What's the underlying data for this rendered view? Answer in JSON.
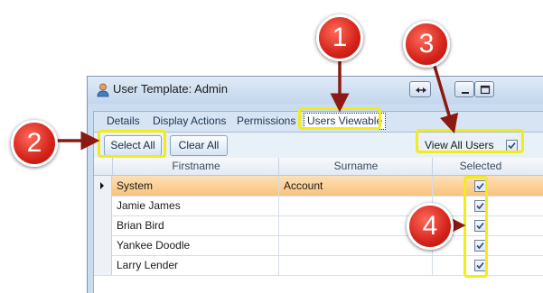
{
  "window": {
    "title": "User Template: Admin"
  },
  "tabs": [
    {
      "label": "Details"
    },
    {
      "label": "Display Actions"
    },
    {
      "label": "Permissions"
    },
    {
      "label": "Users Viewable"
    }
  ],
  "toolbar": {
    "select_all_label": "Select All",
    "clear_all_label": "Clear All",
    "view_all_label": "View All Users",
    "view_all_checked": true
  },
  "grid": {
    "columns": [
      "Firstname",
      "Surname",
      "Selected"
    ],
    "rows": [
      {
        "firstname": "System",
        "surname": "Account",
        "selected": true
      },
      {
        "firstname": "Jamie James",
        "surname": "",
        "selected": true
      },
      {
        "firstname": "Brian Bird",
        "surname": "",
        "selected": true
      },
      {
        "firstname": "Yankee Doodle",
        "surname": "",
        "selected": true
      },
      {
        "firstname": "Larry Lender",
        "surname": "",
        "selected": true
      }
    ]
  },
  "callouts": [
    "1",
    "2",
    "3",
    "4"
  ],
  "colors": {
    "highlight": "#f2ec1b",
    "callout": "#d4231a",
    "selected_row": "#f9c37a"
  },
  "icons": [
    "user-app-icon",
    "restore-icon",
    "minimize-icon",
    "maximize-icon",
    "row-pointer-icon",
    "checkmark-icon"
  ]
}
